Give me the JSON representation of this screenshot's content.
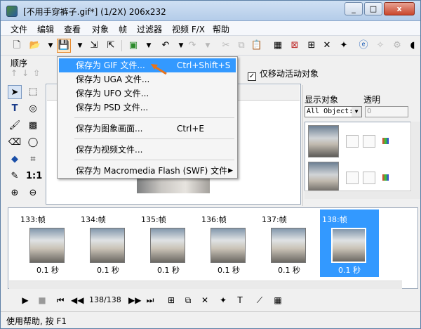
{
  "window": {
    "title": "[不用手穿裤子.gif*] (1/2X)  206x232",
    "minimize": "_",
    "maximize": "□",
    "close": "x"
  },
  "menubar": [
    "文件",
    "编辑",
    "查看",
    "对象",
    "帧",
    "过滤器",
    "视频 F/X",
    "帮助"
  ],
  "sidebar_label": "顺序",
  "checkbox": {
    "label": "仅移动活动对象",
    "checked": true
  },
  "right_panel": {
    "show_objects_label": "显示对象",
    "opacity_label": "透明",
    "select_value": "All Object:",
    "spin_value": "0"
  },
  "dropdown_menu": {
    "items": [
      {
        "label": "保存为 GIF 文件...",
        "shortcut": "Ctrl+Shift+S",
        "highlighted": true
      },
      {
        "label": "保存为 UGA 文件...",
        "shortcut": ""
      },
      {
        "label": "保存为 UFO 文件...",
        "shortcut": ""
      },
      {
        "label": "保存为 PSD 文件...",
        "shortcut": ""
      },
      {
        "label": "保存为图象画面...",
        "shortcut": "Ctrl+E"
      },
      {
        "label": "保存为视频文件...",
        "shortcut": ""
      },
      {
        "label": "保存为 Macromedia Flash (SWF) 文件",
        "shortcut": "",
        "submenu": true
      }
    ]
  },
  "timeline": {
    "frames": [
      {
        "label": "133:帧",
        "duration": "0.1 秒",
        "selected": false
      },
      {
        "label": "134:帧",
        "duration": "0.1 秒",
        "selected": false
      },
      {
        "label": "135:帧",
        "duration": "0.1 秒",
        "selected": false
      },
      {
        "label": "136:帧",
        "duration": "0.1 秒",
        "selected": false
      },
      {
        "label": "137:帧",
        "duration": "0.1 秒",
        "selected": false
      },
      {
        "label": "138:帧",
        "duration": "0.1 秒",
        "selected": true
      }
    ],
    "frame_counter": "138/138"
  },
  "status_bar": "使用帮助, 按 F1",
  "colors": {
    "highlight": "#3399ff",
    "save_highlight_border": "#e68a2e"
  }
}
